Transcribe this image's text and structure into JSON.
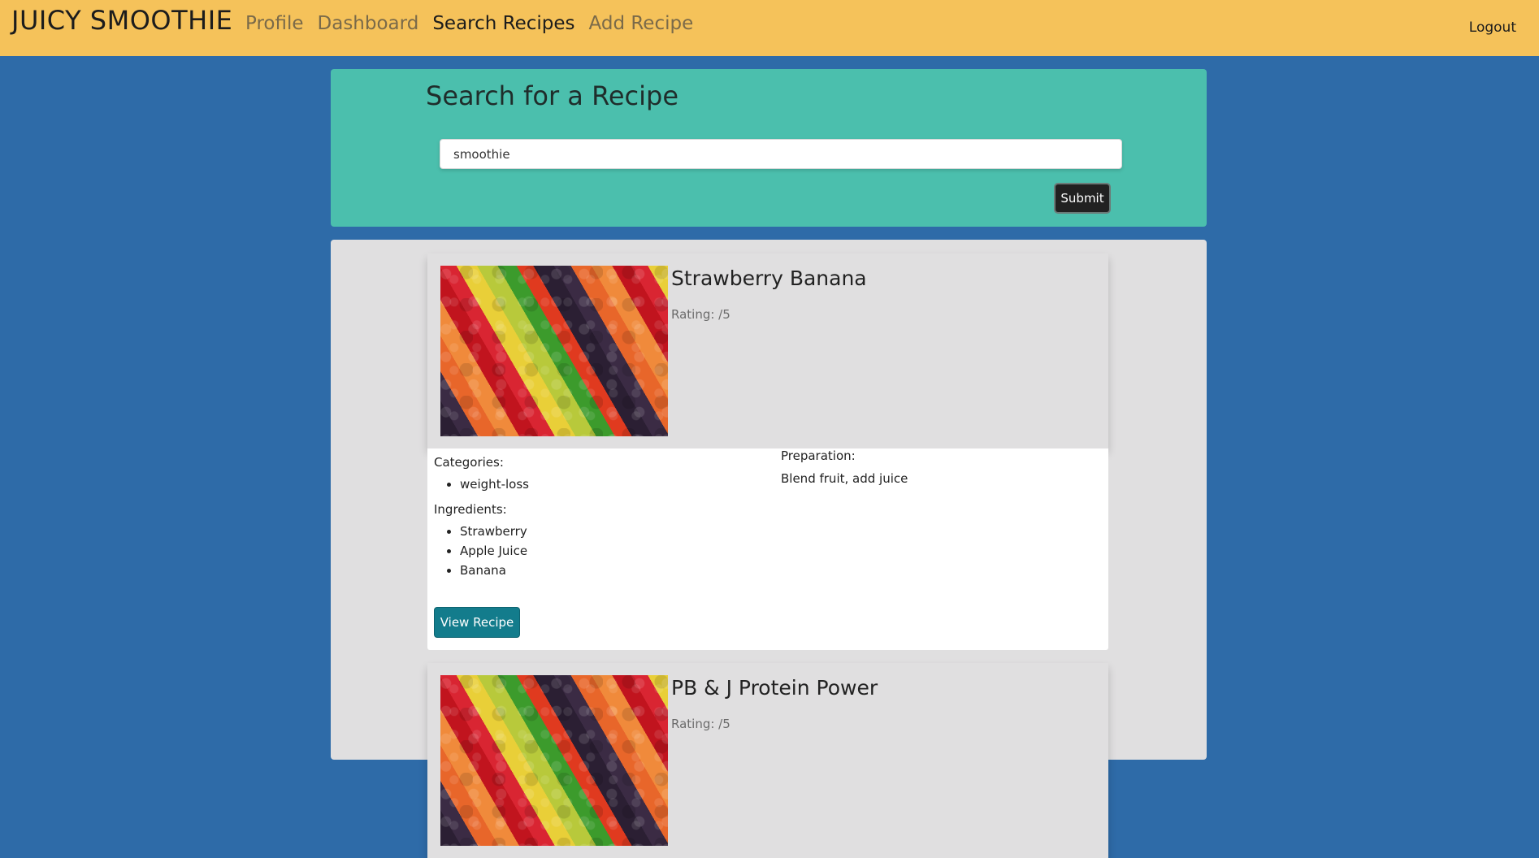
{
  "navbar": {
    "brand": "JUICY SMOOTHIE",
    "links": [
      {
        "label": "Profile",
        "active": false
      },
      {
        "label": "Dashboard",
        "active": false
      },
      {
        "label": "Search Recipes",
        "active": true
      },
      {
        "label": "Add Recipe",
        "active": false
      }
    ],
    "logout_label": "Logout"
  },
  "search": {
    "title": "Search for a Recipe",
    "input_value": "smoothie",
    "submit_label": "Submit"
  },
  "results": [
    {
      "title": "Strawberry Banana",
      "rating_text": "Rating: /5",
      "categories_label": "Categories:",
      "categories": [
        "weight-loss"
      ],
      "ingredients_label": "Ingredients:",
      "ingredients": [
        "Strawberry",
        "Apple Juice",
        "Banana"
      ],
      "preparation_label": "Preparation:",
      "preparation": "Blend fruit, add juice",
      "view_label": "View Recipe"
    },
    {
      "title": "PB & J Protein Power",
      "rating_text": "Rating: /5"
    }
  ],
  "colors": {
    "navbar": "#f5c25a",
    "page_background": "#2e6ba8",
    "search_panel": "#4bbfad",
    "results_panel": "#e0dfe0",
    "view_button": "#137c8c",
    "submit_button": "#212121"
  }
}
